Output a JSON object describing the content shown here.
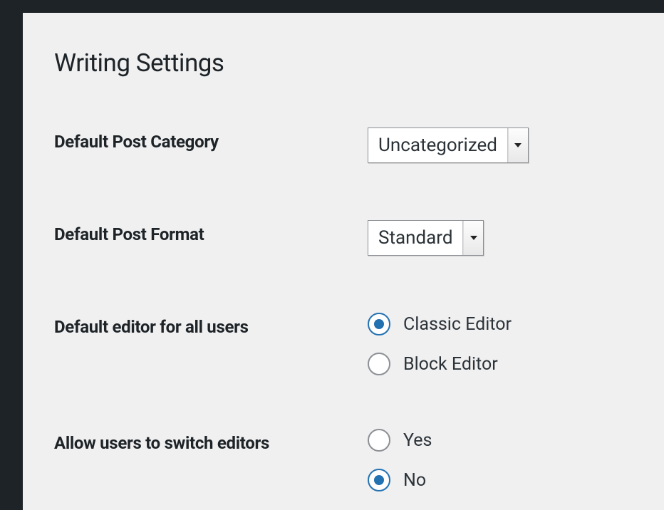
{
  "page": {
    "title": "Writing Settings"
  },
  "fields": {
    "default_post_category": {
      "label": "Default Post Category",
      "value": "Uncategorized"
    },
    "default_post_format": {
      "label": "Default Post Format",
      "value": "Standard"
    },
    "default_editor": {
      "label": "Default editor for all users",
      "options": {
        "classic": {
          "label": "Classic Editor",
          "checked": true
        },
        "block": {
          "label": "Block Editor",
          "checked": false
        }
      }
    },
    "allow_switch": {
      "label": "Allow users to switch editors",
      "options": {
        "yes": {
          "label": "Yes",
          "checked": false
        },
        "no": {
          "label": "No",
          "checked": true
        }
      }
    }
  }
}
